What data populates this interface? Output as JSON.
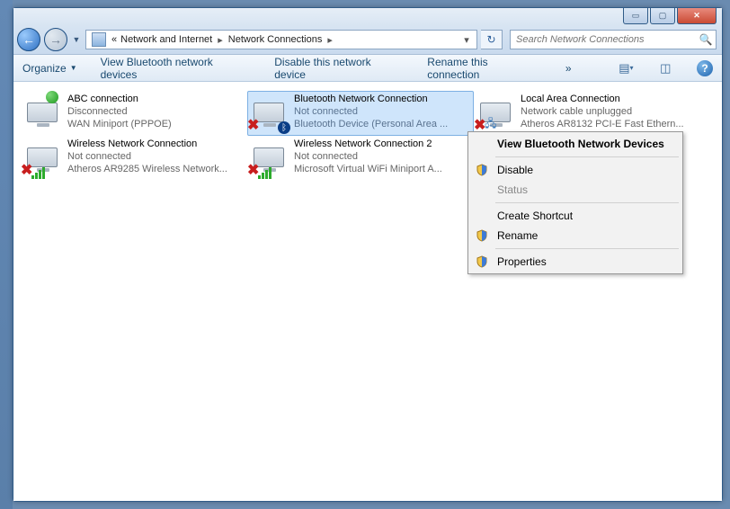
{
  "caption": {
    "min": "▭",
    "max": "▢",
    "close": "✕"
  },
  "breadcrumbs": {
    "root": "«",
    "parent": "Network and Internet",
    "current": "Network Connections"
  },
  "search": {
    "placeholder": "Search Network Connections"
  },
  "toolbar": {
    "organize": "Organize",
    "bt_devices": "View Bluetooth network devices",
    "disable": "Disable this network device",
    "rename": "Rename this connection",
    "more": "»"
  },
  "connections": [
    {
      "name": "ABC connection",
      "status": "Disconnected",
      "device": "WAN Miniport (PPPOE)",
      "kind": "dialup",
      "ok_badge": true
    },
    {
      "name": "Bluetooth Network Connection",
      "status": "Not connected",
      "device": "Bluetooth Device (Personal Area ...",
      "kind": "bluetooth",
      "selected": true
    },
    {
      "name": "Local Area Connection",
      "status": "Network cable unplugged",
      "device": "Atheros AR8132 PCI-E Fast Ethern...",
      "kind": "lan"
    },
    {
      "name": "Wireless Network Connection",
      "status": "Not connected",
      "device": "Atheros AR9285 Wireless Network...",
      "kind": "wifi"
    },
    {
      "name": "Wireless Network Connection 2",
      "status": "Not connected",
      "device": "Microsoft Virtual WiFi Miniport A...",
      "kind": "wifi"
    }
  ],
  "context_menu": {
    "view_bt": "View Bluetooth Network Devices",
    "disable": "Disable",
    "status": "Status",
    "shortcut": "Create Shortcut",
    "rename": "Rename",
    "properties": "Properties"
  }
}
